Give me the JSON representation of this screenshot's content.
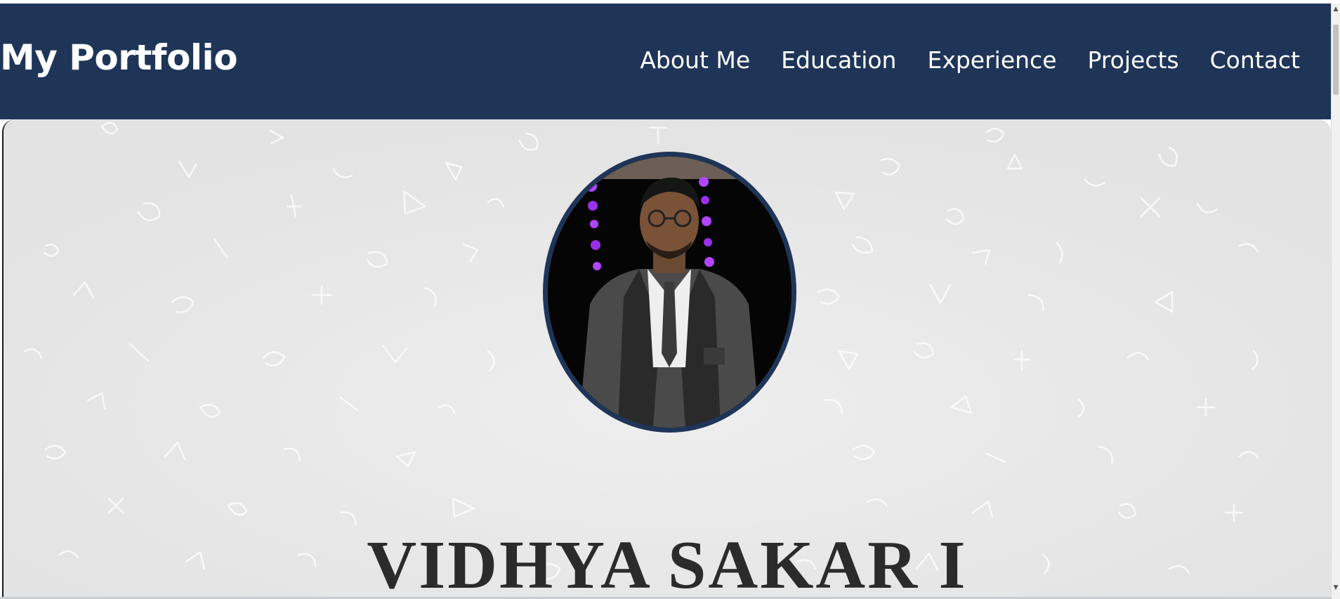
{
  "navbar": {
    "brand": "My Portfolio",
    "links": [
      "About Me",
      "Education",
      "Experience",
      "Projects",
      "Contact"
    ],
    "background_color": "#1f3558"
  },
  "hero": {
    "name": "VIDHYA SAKAR I",
    "background_color": "#e6e6e6",
    "avatar_border_color": "#1f3558"
  },
  "icons": {
    "scroll_up": "scroll-up-arrow-icon",
    "scroll_down": "scroll-down-arrow-icon"
  }
}
